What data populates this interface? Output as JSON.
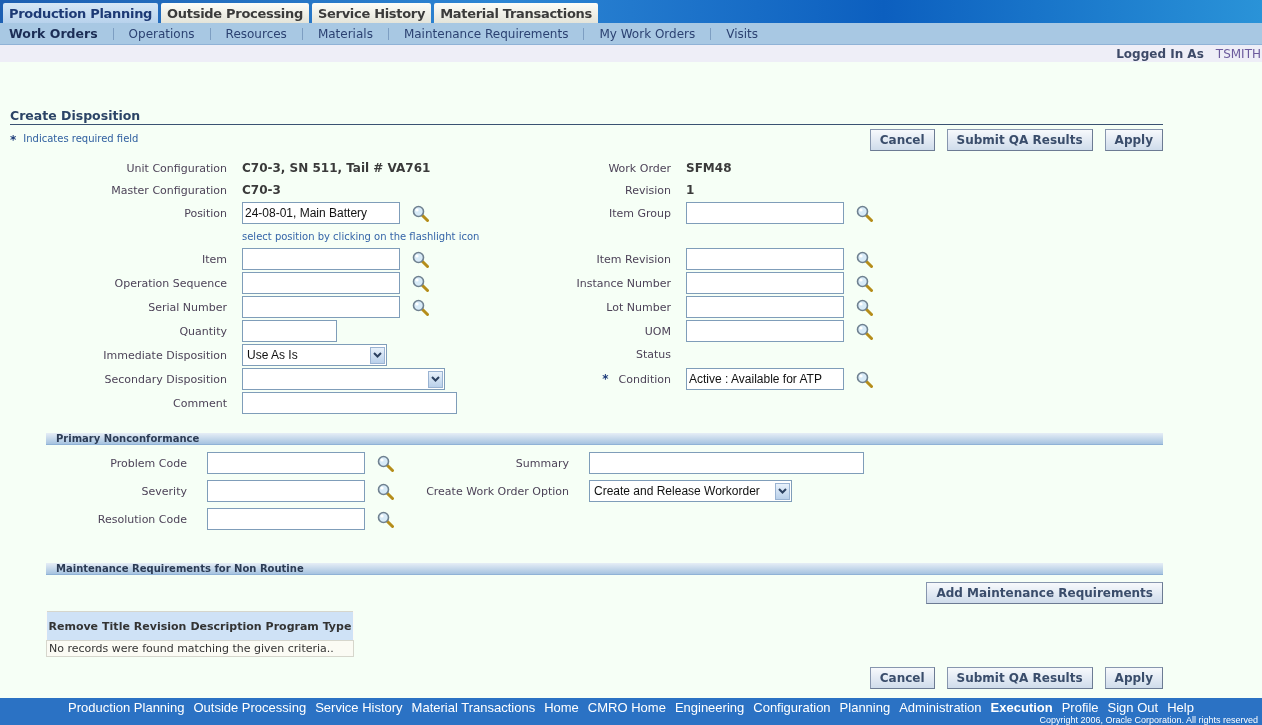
{
  "top_tabs": [
    {
      "label": "Production Planning",
      "selected": true
    },
    {
      "label": "Outside Processing",
      "selected": false
    },
    {
      "label": "Service History",
      "selected": false
    },
    {
      "label": "Material Transactions",
      "selected": false
    }
  ],
  "sub_tabs": [
    {
      "label": "Work Orders",
      "selected": true
    },
    {
      "label": "Operations",
      "selected": false
    },
    {
      "label": "Resources",
      "selected": false
    },
    {
      "label": "Materials",
      "selected": false
    },
    {
      "label": "Maintenance Requirements",
      "selected": false
    },
    {
      "label": "My Work Orders",
      "selected": false
    },
    {
      "label": "Visits",
      "selected": false
    }
  ],
  "user": {
    "label": "Logged In As",
    "name": "TSMITH"
  },
  "title": "Create Disposition",
  "required_legend": {
    "mark": "*",
    "text": "Indicates required field"
  },
  "top_buttons": [
    "Cancel",
    "Submit QA Results",
    "Apply"
  ],
  "form": {
    "left": [
      {
        "label": "Unit Configuration",
        "kind": "display",
        "value": "C70-3, SN 511, Tail # VA761"
      },
      {
        "label": "Master Configuration",
        "kind": "display",
        "value": "C70-3"
      },
      {
        "label": "Position",
        "kind": "lookup",
        "value": "24-08-01, Main Battery",
        "hint": "select position by clicking on the flashlight icon"
      },
      {
        "label": "Item",
        "kind": "lookup"
      },
      {
        "label": "Operation Sequence",
        "kind": "lookup"
      },
      {
        "label": "Serial Number",
        "kind": "lookup"
      },
      {
        "label": "Quantity",
        "kind": "input_short"
      },
      {
        "label": "Immediate Disposition",
        "kind": "select",
        "value": "Use As Is"
      },
      {
        "label": "Secondary Disposition",
        "kind": "select_wide"
      },
      {
        "label": "Comment",
        "kind": "input_long"
      }
    ],
    "right": [
      {
        "label": "Work Order",
        "kind": "display",
        "value": "SFM48"
      },
      {
        "label": "Revision",
        "kind": "display",
        "value": "1"
      },
      {
        "label": "Item Group",
        "kind": "lookup"
      },
      {
        "label": "Item Revision",
        "kind": "lookup"
      },
      {
        "label": "Instance Number",
        "kind": "lookup"
      },
      {
        "label": "Lot Number",
        "kind": "lookup"
      },
      {
        "label": "UOM",
        "kind": "lookup"
      },
      {
        "label": "Status",
        "kind": "display"
      },
      {
        "label": "Condition",
        "kind": "lookup",
        "value": "Active : Available for ATP",
        "required_mark": "*"
      }
    ]
  },
  "nonconformance": {
    "title": "Primary Nonconformance",
    "left": [
      {
        "label": "Problem Code",
        "kind": "lookup"
      },
      {
        "label": "Severity",
        "kind": "lookup"
      },
      {
        "label": "Resolution Code",
        "kind": "lookup"
      }
    ],
    "right": [
      {
        "label": "Summary",
        "kind": "input_summary"
      },
      {
        "label": "Create Work Order Option",
        "kind": "select_wide",
        "value": "Create and Release Workorder"
      }
    ]
  },
  "requirements": {
    "title": "Maintenance Requirements for Non Routine",
    "button": "Add Maintenance Requirements",
    "table": {
      "columns": [
        "Remove",
        "Title",
        "Revision",
        "Description",
        "Program Type"
      ],
      "empty_message": "No records were found matching the given criteria.."
    }
  },
  "bottom_buttons": [
    "Cancel",
    "Submit QA Results",
    "Apply"
  ],
  "footer": {
    "links": [
      {
        "label": "Production Planning",
        "selected": false
      },
      {
        "label": "Outside Processing",
        "selected": false
      },
      {
        "label": "Service History",
        "selected": false
      },
      {
        "label": "Material Transactions",
        "selected": false
      },
      {
        "label": "Home",
        "selected": false
      },
      {
        "label": "CMRO Home",
        "selected": false
      },
      {
        "label": "Engineering",
        "selected": false
      },
      {
        "label": "Configuration",
        "selected": false
      },
      {
        "label": "Planning",
        "selected": false
      },
      {
        "label": "Administration",
        "selected": false
      },
      {
        "label": "Execution",
        "selected": true
      },
      {
        "label": "Profile",
        "selected": false
      },
      {
        "label": "Sign Out",
        "selected": false
      },
      {
        "label": "Help",
        "selected": false
      }
    ],
    "copyright": "Copyright 2006, Oracle Corporation. All rights reserved"
  }
}
